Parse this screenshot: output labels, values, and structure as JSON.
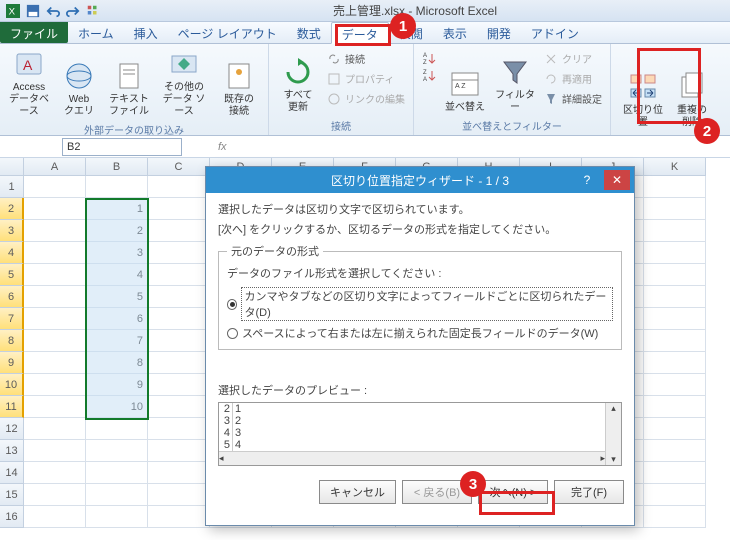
{
  "window_title": "売上管理.xlsx - Microsoft Excel",
  "tabs": {
    "file": "ファイル",
    "home": "ホーム",
    "insert": "挿入",
    "page_layout": "ページ レイアウト",
    "formulas": "数式",
    "data": "データ",
    "review": "校閲",
    "view": "表示",
    "developer": "開発",
    "addins": "アドイン"
  },
  "ribbon": {
    "ext": {
      "access": "Access\nデータベース",
      "web": "Web\nクエリ",
      "text": "テキスト\nファイル",
      "other": "その他の\nデータ ソース",
      "existing": "既存の\n接続",
      "label": "外部データの取り込み"
    },
    "conn": {
      "refresh": "すべて\n更新",
      "connections": "接続",
      "properties": "プロパティ",
      "editlinks": "リンクの編集",
      "label": "接続"
    },
    "sort": {
      "sort": "並べ替え",
      "filter": "フィルター",
      "clear": "クリア",
      "reapply": "再適用",
      "advanced": "詳細設定",
      "label": "並べ替えとフィルター"
    },
    "texttools": {
      "texttocolumns": "区切り位置",
      "removedup": "重複の\n削除"
    }
  },
  "namebox": "B2",
  "cols": [
    "A",
    "B",
    "C",
    "D",
    "E",
    "F",
    "G",
    "H",
    "I",
    "J",
    "K"
  ],
  "rowvals": [
    "1",
    "2",
    "3",
    "4",
    "5",
    "6",
    "7",
    "8",
    "9",
    "10"
  ],
  "wizard": {
    "title": "区切り位置指定ウィザード - 1 / 3",
    "intro1": "選択したデータは区切り文字で区切られています。",
    "intro2": "[次へ] をクリックするか、区切るデータの形式を指定してください。",
    "groupbox": "元のデータの形式",
    "radio_label": "データのファイル形式を選択してください :",
    "radio1": "カンマやタブなどの区切り文字によってフィールドごとに区切られたデータ(D)",
    "radio2": "スペースによって右または左に揃えられた固定長フィールドのデータ(W)",
    "preview_label": "選択したデータのプレビュー :",
    "preview_lines": [
      "1",
      "2",
      "3",
      "4"
    ],
    "btn_cancel": "キャンセル",
    "btn_back": "< 戻る(B)",
    "btn_next": "次へ(N) >",
    "btn_finish": "完了(F)"
  },
  "callouts": {
    "one": "1",
    "two": "2",
    "three": "3"
  }
}
